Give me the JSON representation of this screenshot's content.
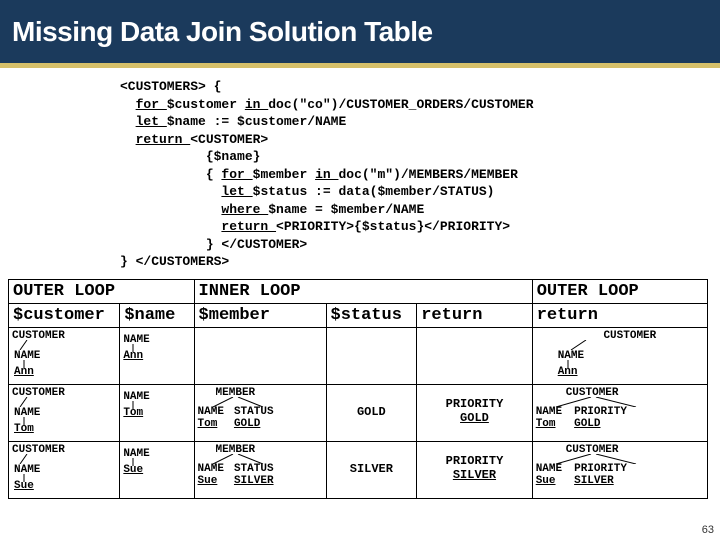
{
  "header": {
    "title": "Missing Data Join Solution Table"
  },
  "code": {
    "l1_a": "<CUSTOMERS> {",
    "l2_a": "  ",
    "l2_for": "for ",
    "l2_b": "$customer ",
    "l2_in": "in ",
    "l2_c": "doc(\"co\")/CUSTOMER_ORDERS/CUSTOMER",
    "l3_a": "  ",
    "l3_let": "let ",
    "l3_b": "$name := $customer/NAME",
    "l4_a": "  ",
    "l4_ret": "return ",
    "l4_b": "<CUSTOMER>",
    "l5": "           {$name}",
    "l6_a": "           { ",
    "l6_for": "for ",
    "l6_b": "$member ",
    "l6_in": "in ",
    "l6_c": "doc(\"m\")/MEMBERS/MEMBER",
    "l7_a": "             ",
    "l7_let": "let ",
    "l7_b": "$status := data($member/STATUS)",
    "l8_a": "             ",
    "l8_where": "where ",
    "l8_b": "$name = $member/NAME",
    "l9_a": "             ",
    "l9_ret": "return ",
    "l9_b": "<PRIORITY>{$status}</PRIORITY>",
    "l10": "           } </CUSTOMER>",
    "l11": "} </CUSTOMERS>"
  },
  "table": {
    "head1": {
      "outer1": "OUTER LOOP",
      "inner": "INNER LOOP",
      "outer2": "OUTER LOOP"
    },
    "head2": {
      "c1": "$customer",
      "c2": "$name",
      "c3": "$member",
      "c4": "$status",
      "c5": "return",
      "c6": "return"
    }
  },
  "labels": {
    "CUSTOMER": "CUSTOMER",
    "NAME": "NAME",
    "MEMBER": "MEMBER",
    "STATUS": "STATUS",
    "PRIORITY": "PRIORITY"
  },
  "names": {
    "ann": "Ann",
    "tom": "Tom",
    "sue": "Sue"
  },
  "status": {
    "gold": "GOLD",
    "silver": "SILVER"
  },
  "pagenum": "63",
  "chart_data": {
    "type": "table",
    "title": "Missing Data Join Solution Table",
    "columns_outer": [
      "$customer",
      "$name"
    ],
    "columns_inner": [
      "$member",
      "$status",
      "return"
    ],
    "columns_outer_return": [
      "return"
    ],
    "rows": [
      {
        "$customer": {
          "tag": "CUSTOMER",
          "children": [
            {
              "tag": "NAME",
              "value": "Ann"
            }
          ]
        },
        "$name": {
          "tag": "NAME",
          "value": "Ann"
        },
        "$member": null,
        "$status": null,
        "inner_return": null,
        "outer_return": {
          "tag": "CUSTOMER",
          "children": [
            {
              "tag": "NAME",
              "value": "Ann"
            }
          ]
        }
      },
      {
        "$customer": {
          "tag": "CUSTOMER",
          "children": [
            {
              "tag": "NAME",
              "value": "Tom"
            }
          ]
        },
        "$name": {
          "tag": "NAME",
          "value": "Tom"
        },
        "$member": {
          "tag": "MEMBER",
          "children": [
            {
              "tag": "NAME",
              "value": "Tom"
            },
            {
              "tag": "STATUS",
              "value": "GOLD"
            }
          ]
        },
        "$status": "GOLD",
        "inner_return": {
          "tag": "PRIORITY",
          "value": "GOLD"
        },
        "outer_return": {
          "tag": "CUSTOMER",
          "children": [
            {
              "tag": "NAME",
              "value": "Tom"
            },
            {
              "tag": "PRIORITY",
              "value": "GOLD"
            }
          ]
        }
      },
      {
        "$customer": {
          "tag": "CUSTOMER",
          "children": [
            {
              "tag": "NAME",
              "value": "Sue"
            }
          ]
        },
        "$name": {
          "tag": "NAME",
          "value": "Sue"
        },
        "$member": {
          "tag": "MEMBER",
          "children": [
            {
              "tag": "NAME",
              "value": "Sue"
            },
            {
              "tag": "STATUS",
              "value": "SILVER"
            }
          ]
        },
        "$status": "SILVER",
        "inner_return": {
          "tag": "PRIORITY",
          "value": "SILVER"
        },
        "outer_return": {
          "tag": "CUSTOMER",
          "children": [
            {
              "tag": "NAME",
              "value": "Sue"
            },
            {
              "tag": "PRIORITY",
              "value": "SILVER"
            }
          ]
        }
      }
    ]
  }
}
